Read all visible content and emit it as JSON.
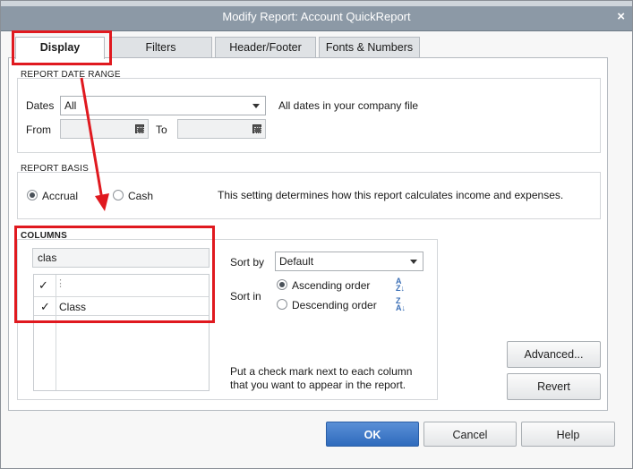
{
  "window": {
    "title": "Modify Report: Account QuickReport",
    "close_glyph": "×"
  },
  "tabs": [
    {
      "label": "Display",
      "active": true
    },
    {
      "label": "Filters",
      "active": false
    },
    {
      "label": "Header/Footer",
      "active": false
    },
    {
      "label": "Fonts & Numbers",
      "active": false
    }
  ],
  "date_range": {
    "title": "REPORT DATE RANGE",
    "dates_label": "Dates",
    "dates_value": "All",
    "dates_hint": "All dates in your company file",
    "from_label": "From",
    "from_value": "",
    "to_label": "To",
    "to_value": ""
  },
  "basis": {
    "title": "REPORT BASIS",
    "accrual_label": "Accrual",
    "cash_label": "Cash",
    "selected": "Accrual",
    "hint": "This setting determines how this report calculates income and expenses."
  },
  "columns": {
    "title": "COLUMNS",
    "search_value": "clas",
    "header_check": "✓",
    "header_dots": "⋮",
    "items": [
      {
        "check": "✓",
        "name": "Class",
        "checked": true
      }
    ],
    "sort_by_label": "Sort by",
    "sort_by_value": "Default",
    "sort_in_label": "Sort in",
    "ascending_label": "Ascending order",
    "descending_label": "Descending order",
    "sort_selected": "Ascending order",
    "hint_line1": "Put a check mark next to each column",
    "hint_line2": "that you want to appear in the report."
  },
  "buttons": {
    "advanced": "Advanced...",
    "revert": "Revert",
    "ok": "OK",
    "cancel": "Cancel",
    "help": "Help"
  },
  "annotation_color": "#e0191f"
}
